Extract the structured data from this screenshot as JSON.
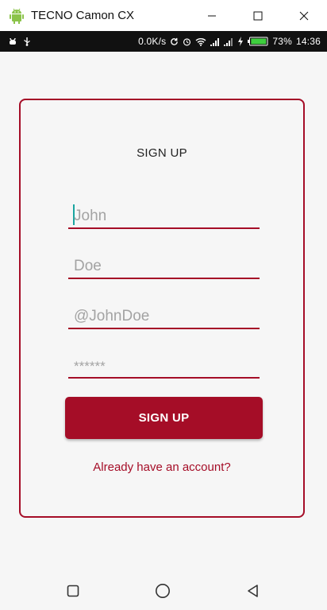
{
  "window": {
    "title": "TECNO Camon CX",
    "app_icon": "android-icon",
    "controls": [
      "minimize-icon",
      "maximize-icon",
      "close-icon"
    ]
  },
  "statusbar": {
    "left_icons": [
      "usb-debug-icon",
      "usb-icon"
    ],
    "speed": "0.0K/s",
    "right_icons": [
      "sync-icon",
      "alarm-icon",
      "wifi-icon",
      "signal-icon",
      "signal-icon",
      "charging-icon",
      "battery-icon"
    ],
    "battery_percent": "73%",
    "battery_level": 0.73,
    "time": "14:36"
  },
  "form": {
    "title": "SIGN UP",
    "fields": [
      {
        "name": "first-name-field",
        "value": "John"
      },
      {
        "name": "last-name-field",
        "value": "Doe"
      },
      {
        "name": "username-field",
        "value": "@JohnDoe"
      },
      {
        "name": "password-field",
        "value": "******"
      }
    ],
    "submit_label": "SIGN UP",
    "login_link": "Already have an account?"
  },
  "navbar": {
    "items": [
      "recents-icon",
      "home-icon",
      "back-icon"
    ]
  },
  "colors": {
    "accent": "#a50d27",
    "cursor": "#1aa5a0",
    "placeholder_text": "#a3a3a3",
    "statusbar_bg": "#111111"
  }
}
